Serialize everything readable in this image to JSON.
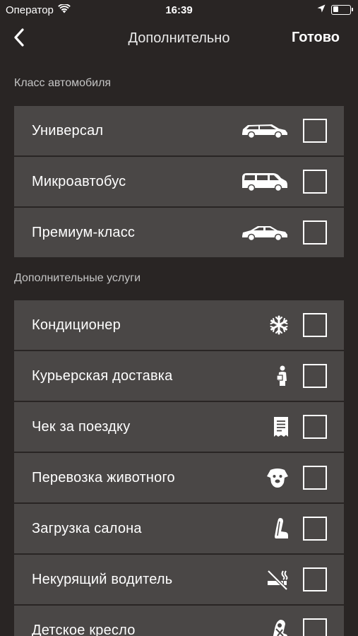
{
  "status_bar": {
    "carrier": "Оператор",
    "time": "16:39",
    "battery_level": 0.35
  },
  "nav": {
    "title": "Дополнительно",
    "done_label": "Готово"
  },
  "sections": [
    {
      "header": "Класс автомобиля",
      "items": [
        {
          "label": "Универсал",
          "icon": "station-wagon-icon",
          "checked": false
        },
        {
          "label": "Микроавтобус",
          "icon": "minibus-icon",
          "checked": false
        },
        {
          "label": "Премиум-класс",
          "icon": "premium-car-icon",
          "checked": false
        }
      ]
    },
    {
      "header": "Дополнительные услуги",
      "items": [
        {
          "label": "Кондиционер",
          "icon": "snowflake-icon",
          "checked": false
        },
        {
          "label": "Курьерская доставка",
          "icon": "courier-icon",
          "checked": false
        },
        {
          "label": "Чек за поездку",
          "icon": "receipt-icon",
          "checked": false
        },
        {
          "label": "Перевозка животного",
          "icon": "dog-icon",
          "checked": false
        },
        {
          "label": "Загрузка салона",
          "icon": "car-seat-icon",
          "checked": false
        },
        {
          "label": "Некурящий водитель",
          "icon": "no-smoking-icon",
          "checked": false
        },
        {
          "label": "Детское кресло",
          "icon": "child-seat-icon",
          "checked": false
        }
      ]
    }
  ],
  "colors": {
    "background": "#292524",
    "row": "#4a4746",
    "header_text": "#c4c4c4"
  }
}
